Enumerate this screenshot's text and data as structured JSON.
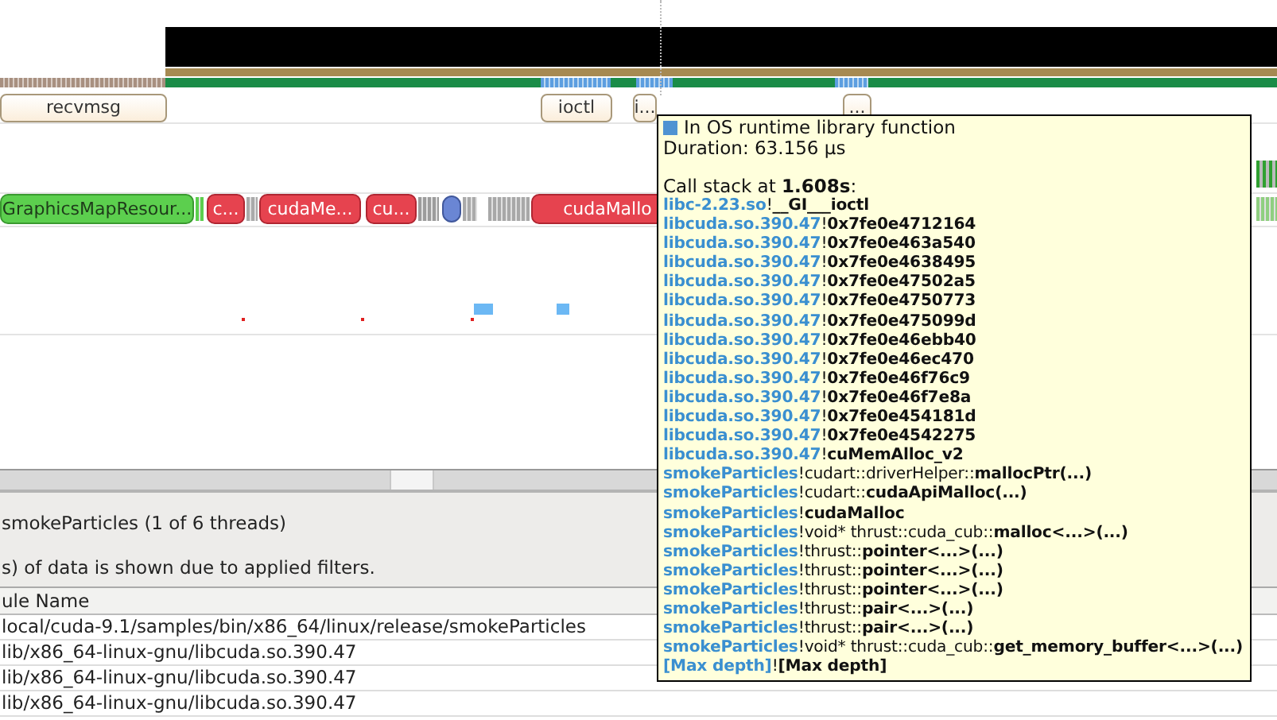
{
  "timeline": {
    "os_runtime_ranges": [
      {
        "label": "recvmsg"
      },
      {
        "label": "ioctl"
      },
      {
        "label": "i..."
      },
      {
        "label": "..."
      }
    ],
    "cuda_api_ranges": [
      {
        "label": "GraphicsMapResour...",
        "kind": "success"
      },
      {
        "label": "c...",
        "kind": "error"
      },
      {
        "label": "cudaMe...",
        "kind": "error"
      },
      {
        "label": "cu...",
        "kind": "error"
      },
      {
        "label": "cudaMallo",
        "kind": "error"
      }
    ]
  },
  "tooltip": {
    "title": "In OS runtime library function",
    "duration": "Duration: 63.156 µs",
    "call_stack": "Call stack at **1.608s**:",
    "frames": [
      {
        "module": "libc-2.23.so",
        "separator": "!",
        "function": "__GI___ioctl"
      },
      {
        "module": "libcuda.so.390.47",
        "separator": "!",
        "function": "0x7fe0e4712164"
      },
      {
        "module": "libcuda.so.390.47",
        "separator": "!",
        "function": "0x7fe0e463a540"
      },
      {
        "module": "libcuda.so.390.47",
        "separator": "!",
        "function": "0x7fe0e4638495"
      },
      {
        "module": "libcuda.so.390.47",
        "separator": "!",
        "function": "0x7fe0e47502a5"
      },
      {
        "module": "libcuda.so.390.47",
        "separator": "!",
        "function": "0x7fe0e4750773"
      },
      {
        "module": "libcuda.so.390.47",
        "separator": "!",
        "function": "0x7fe0e475099d"
      },
      {
        "module": "libcuda.so.390.47",
        "separator": "!",
        "function": "0x7fe0e46ebb40"
      },
      {
        "module": "libcuda.so.390.47",
        "separator": "!",
        "function": "0x7fe0e46ec470"
      },
      {
        "module": "libcuda.so.390.47",
        "separator": "!",
        "function": "0x7fe0e46f76c9"
      },
      {
        "module": "libcuda.so.390.47",
        "separator": "!",
        "function": "0x7fe0e46f7e8a"
      },
      {
        "module": "libcuda.so.390.47",
        "separator": "!",
        "function": "0x7fe0e454181d"
      },
      {
        "module": "libcuda.so.390.47",
        "separator": "!",
        "function": "0x7fe0e4542275"
      },
      {
        "module": "libcuda.so.390.47",
        "separator": "!",
        "function": "cuMemAlloc_v2"
      },
      {
        "module": "smokeParticles",
        "separator": "!",
        "scope": "cudart::driverHelper::",
        "function": "mallocPtr(...)"
      },
      {
        "module": "smokeParticles",
        "separator": "!",
        "scope": "cudart::",
        "function": "cudaApiMalloc(...)"
      },
      {
        "module": "smokeParticles",
        "separator": "!",
        "function": "cudaMalloc"
      },
      {
        "module": "smokeParticles",
        "separator": "!",
        "scope": "void* thrust::cuda_cub::",
        "function": "malloc<...>(...)"
      },
      {
        "module": "smokeParticles",
        "separator": "!",
        "scope": "thrust::",
        "function": "pointer<...>(...)"
      },
      {
        "module": "smokeParticles",
        "separator": "!",
        "scope": "thrust::",
        "function": "pointer<...>(...)"
      },
      {
        "module": "smokeParticles",
        "separator": "!",
        "scope": "thrust::",
        "function": "pointer<...>(...)"
      },
      {
        "module": "smokeParticles",
        "separator": "!",
        "scope": "thrust::",
        "function": "pair<...>(...)"
      },
      {
        "module": "smokeParticles",
        "separator": "!",
        "scope": "thrust::",
        "function": "pair<...>(...)"
      },
      {
        "module": "smokeParticles",
        "separator": "!",
        "scope": "void* thrust::cuda_cub::",
        "function": "get_memory_buffer<...>(...)"
      },
      {
        "module": "[Max depth]",
        "separator": "!",
        "function": "[Max depth]"
      }
    ]
  },
  "panel": {
    "thread_info": "smokeParticles (1 of 6 threads)",
    "filter_note": "s) of data is shown due to applied filters.",
    "table": {
      "columns": [
        "ule Name"
      ],
      "rows": [
        [
          "local/cuda-9.1/samples/bin/x86_64/linux/release/smokeParticles"
        ],
        [
          "lib/x86_64-linux-gnu/libcuda.so.390.47"
        ],
        [
          "lib/x86_64-linux-gnu/libcuda.so.390.47"
        ],
        [
          "lib/x86_64-linux-gnu/libcuda.so.390.47"
        ]
      ]
    }
  }
}
